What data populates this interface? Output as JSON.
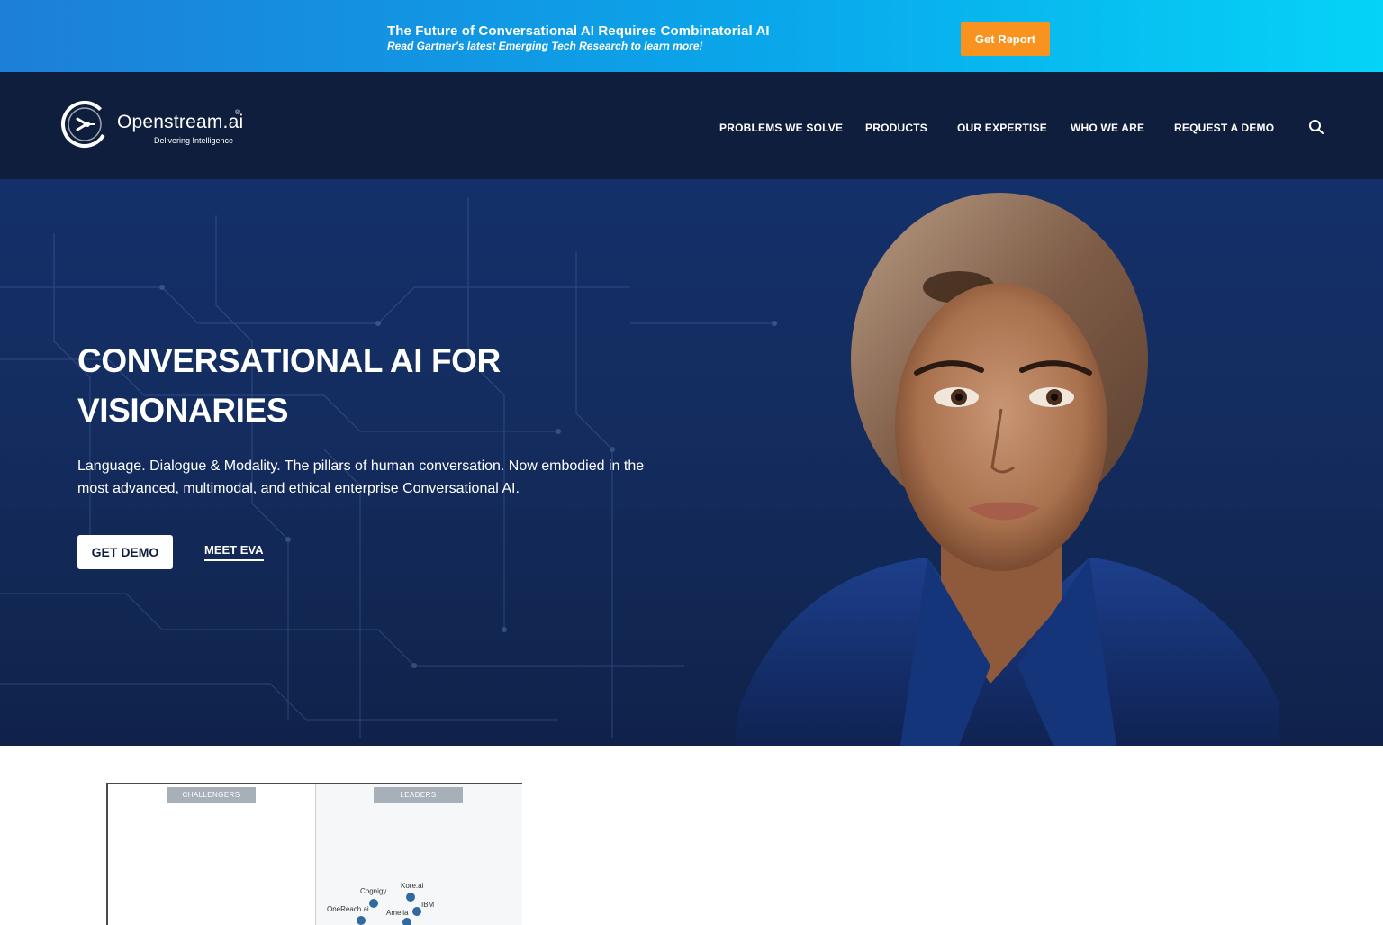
{
  "banner": {
    "title": "The Future of Conversational AI Requires Combinatorial AI",
    "subtitle": "Read Gartner's latest Emerging Tech Research to learn more!",
    "button_label": "Get Report",
    "colors": {
      "gradient_start": "#1d7fd8",
      "gradient_end": "#05d3f7",
      "button": "#f7931e"
    }
  },
  "header": {
    "logo_name": "Openstream.ai",
    "logo_reg": "®",
    "logo_tagline": "Delivering Intelligence",
    "nav": [
      {
        "label": "PROBLEMS WE SOLVE"
      },
      {
        "label": "PRODUCTS"
      },
      {
        "label": "OUR EXPERTISE"
      },
      {
        "label": "WHO WE ARE"
      },
      {
        "label": "REQUEST A DEMO"
      }
    ],
    "search_icon": "search-icon",
    "background": "#0f1e3d"
  },
  "hero": {
    "title_line1": "CONVERSATIONAL AI FOR",
    "title_line2": "VISIONARIES",
    "subtitle": "Language. Dialogue & Modality. The pillars of human conversation. Now embodied in the most advanced, multimodal, and ethical enterprise Conversational AI.",
    "primary_button": "GET DEMO",
    "secondary_link": "MEET EVA"
  },
  "quadrant": {
    "labels": [
      "CHALLENGERS",
      "LEADERS"
    ],
    "vendors": [
      "Kore.ai",
      "Cognigy",
      "IBM",
      "OneReach.ai",
      "Amelia"
    ]
  }
}
